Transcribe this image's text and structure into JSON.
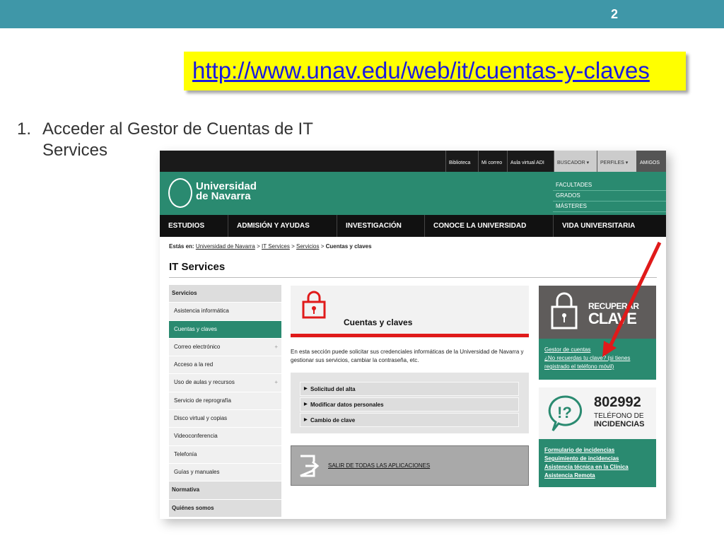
{
  "slide": {
    "number": "2",
    "url": "http://www.unav.edu/web/it/cuentas-y-claves",
    "step_number": "1.",
    "step_text": "Acceder al Gestor de Cuentas de IT Services"
  },
  "utility_bar": [
    "Biblioteca",
    "Mi correo",
    "Aula virtual ADI",
    "BUSCADOR ▾",
    "PERFILES ▾",
    "AMIGOS"
  ],
  "logo": {
    "line1": "Universidad",
    "line2": "de Navarra"
  },
  "faculty_links": [
    "FACULTADES",
    "GRADOS",
    "MÁSTERES"
  ],
  "main_nav": [
    "ESTUDIOS",
    "ADMISIÓN Y AYUDAS",
    "INVESTIGACIÓN",
    "CONOCE LA UNIVERSIDAD",
    "VIDA UNIVERSITARIA"
  ],
  "breadcrumb": {
    "prefix": "Estás en:",
    "items": [
      "Universidad de Navarra",
      "IT Services",
      "Servicios"
    ],
    "current": "Cuentas y claves",
    "sep": ">"
  },
  "page_title": "IT Services",
  "sidebar": [
    {
      "label": "Servicios",
      "type": "head"
    },
    {
      "label": "Asistencia informática",
      "type": "item"
    },
    {
      "label": "Cuentas y claves",
      "type": "active"
    },
    {
      "label": "Correo electrónico",
      "type": "item",
      "plus": "+"
    },
    {
      "label": "Acceso a la red",
      "type": "item"
    },
    {
      "label": "Uso de aulas y recursos",
      "type": "item",
      "plus": "+"
    },
    {
      "label": "Servicio de reprografía",
      "type": "item"
    },
    {
      "label": "Disco virtual y copias",
      "type": "item"
    },
    {
      "label": "Videoconferencia",
      "type": "item"
    },
    {
      "label": "Telefonía",
      "type": "item"
    },
    {
      "label": "Guías y manuales",
      "type": "item"
    },
    {
      "label": "Normativa",
      "type": "head"
    },
    {
      "label": "Quiénes somos",
      "type": "head"
    }
  ],
  "card_title": "Cuentas y claves",
  "description": "En esta sección puede solicitar sus credenciales informáticas de la Universidad de Navarra y gestionar sus servicios, cambiar la contraseña, etc.",
  "accordion": [
    "Solicitud del alta",
    "Modificar datos personales",
    "Cambio de clave"
  ],
  "logout": "SALIR DE TODAS LAS APLICACIONES",
  "recover": {
    "line1": "RECUPERAR",
    "line2": "CLAVE",
    "link1": "Gestor de cuentas",
    "link2": "¿No recuerdas tu clave? (si tienes registrado el teléfono móvil)"
  },
  "phone": {
    "number": "802992",
    "line1": "TELÉFONO DE",
    "line2": "INCIDENCIAS"
  },
  "incidents": [
    "Formulario de incidencias",
    "Seguimiento de incidencias",
    "Asistencia técnica en la Clínica",
    "Asistencia Remota"
  ],
  "colors": {
    "teal": "#2a8a70",
    "red": "#e01a1a",
    "top_bar": "#3f97a8",
    "highlight": "#ffff00"
  }
}
